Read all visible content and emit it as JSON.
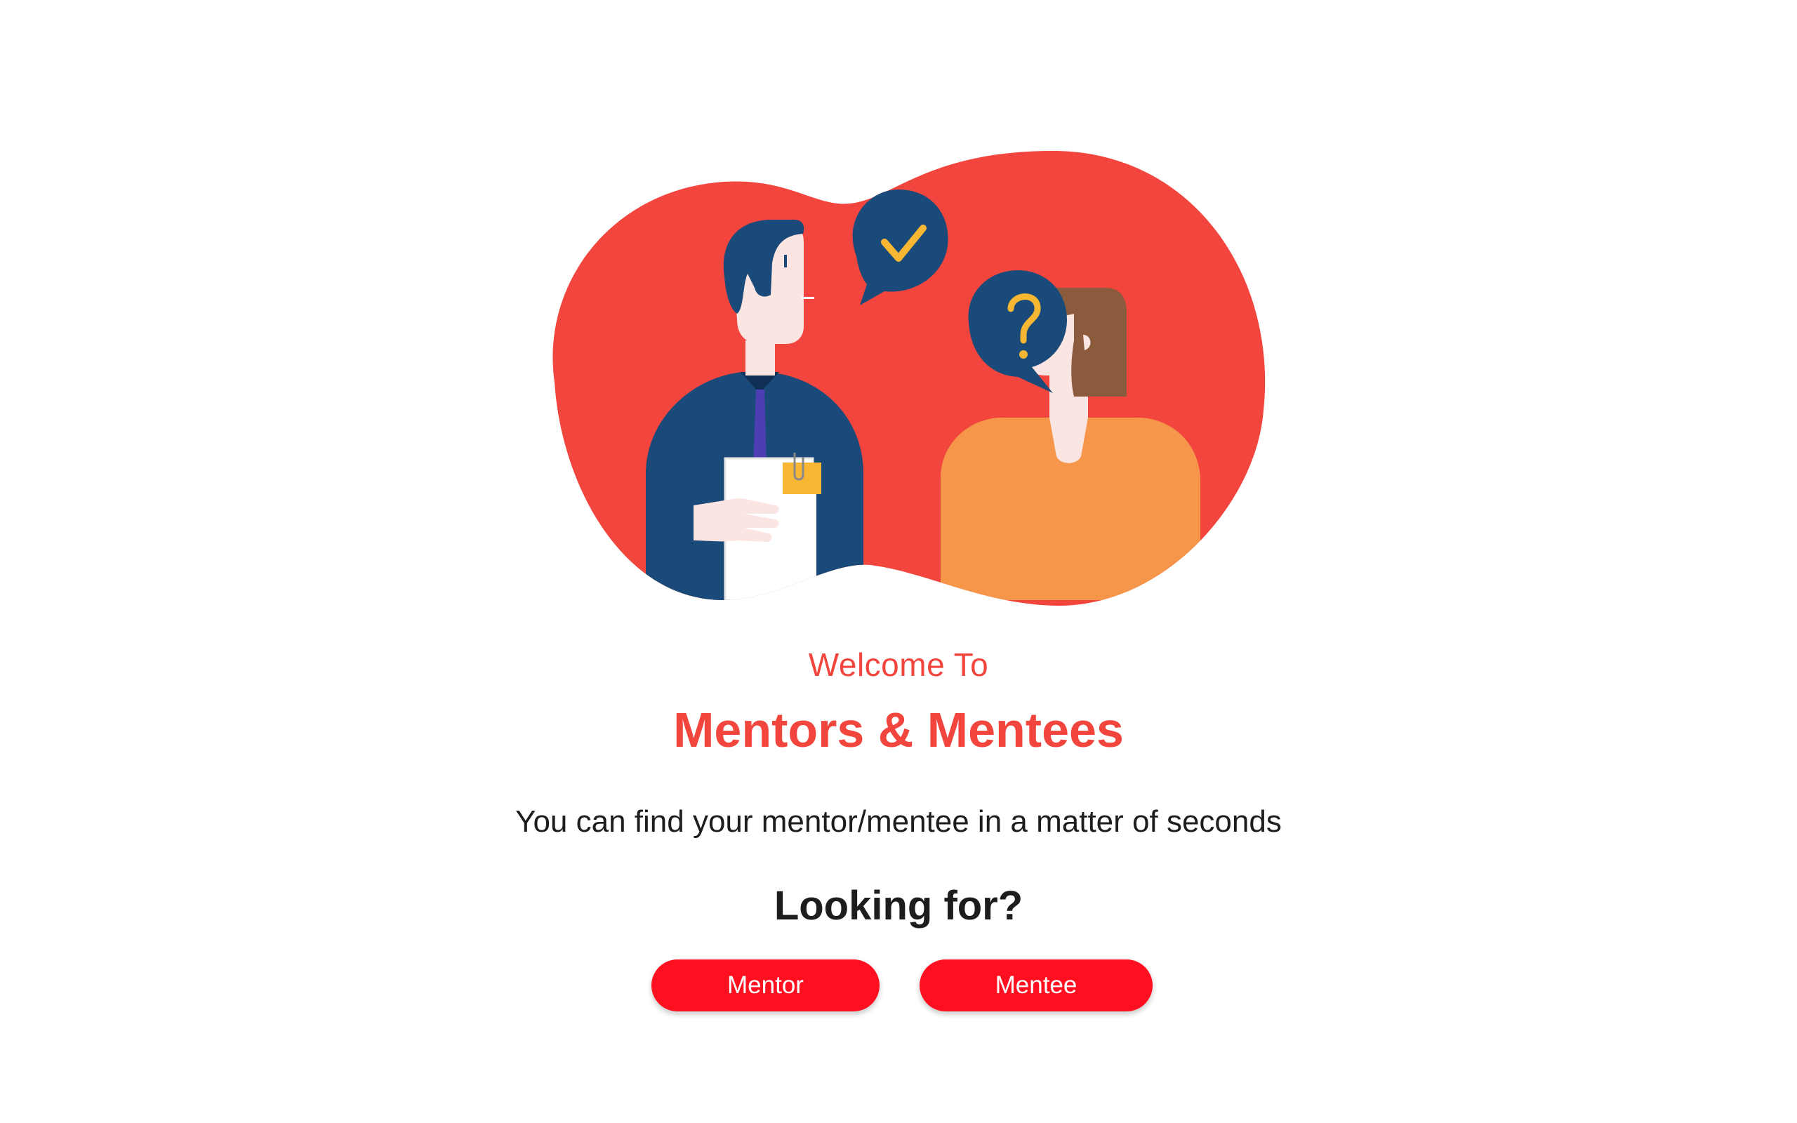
{
  "welcome_text": "Welcome To",
  "app_title": "Mentors & Mentees",
  "tagline": "You can find your mentor/mentee in a matter of seconds",
  "question": "Looking for?",
  "buttons": {
    "mentor_label": "Mentor",
    "mentee_label": "Mentee"
  },
  "colors": {
    "brand_red": "#f2453d",
    "button_red": "#ff0f1f",
    "text_dark": "#1d1d1f",
    "navy": "#1a4a7a",
    "orange": "#f5964a",
    "yellow": "#f7b733"
  },
  "illustration": {
    "icons": [
      "checkmark-speech-bubble-icon",
      "question-speech-bubble-icon"
    ]
  }
}
